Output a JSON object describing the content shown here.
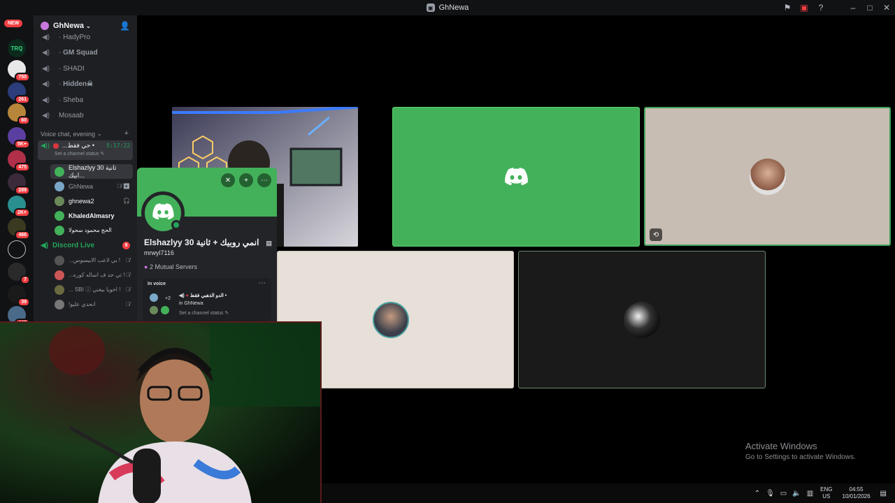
{
  "window": {
    "title": "GhNewa"
  },
  "server_rail": {
    "new_label": "NEW",
    "badges": [
      "750",
      "261",
      "60",
      "5K+",
      "475",
      "289",
      "2K+",
      "466",
      "7",
      "39",
      "445"
    ],
    "logo_text": "TRQ"
  },
  "guild": {
    "name": "GhNewa"
  },
  "channels": {
    "top": [
      {
        "name": "HadyPro",
        "prefix": "·"
      },
      {
        "name": "GM Squad",
        "prefix": "·"
      },
      {
        "name": "SHADI",
        "prefix": "·"
      },
      {
        "name": "Hidden☠",
        "prefix": "·"
      },
      {
        "name": "Sheba",
        "prefix": "·"
      },
      {
        "name": "Mosaab",
        "prefix": ""
      }
    ],
    "category": "Voice chat, evening",
    "active": {
      "name": "...حي فقط •",
      "timer": "5:17:22",
      "status": "Set a channel status"
    },
    "members": [
      {
        "name": "Elshazlyy 30 ثانية ابيك...",
        "color": "#43b15a"
      },
      {
        "name": "GhNewa",
        "color": "#7aa7c7"
      },
      {
        "name": "ghnewa2",
        "color": "#6b8a5a"
      },
      {
        "name": "KhaledAlmasry",
        "color": "#43b15a"
      },
      {
        "name": "الحج محمود سحولا",
        "color": "#43b15a"
      }
    ],
    "live_category": "Discord Live",
    "live_count": "9",
    "live_members": [
      {
        "name": "...بي لاعب الابيسوس !",
        "color": "#555"
      },
      {
        "name": "...تي حد ف اساله كوره !",
        "color": "#c55"
      },
      {
        "name": "... SBI ⓘ اخويا بيغني !",
        "color": "#6a6a40"
      },
      {
        "name": "!انحدي عليو",
        "color": "#777"
      }
    ]
  },
  "popout": {
    "display_name": "Elshazlyy 30 انمي روبيك + ثانية",
    "handle": "mrwyl7116",
    "mutual": "2 Mutual Servers",
    "in_voice_label": "In voice",
    "channel_name": "الدو الذهبي فقط •",
    "in_guild": "in GhNewa",
    "status": "Set a channel status",
    "plus_count": "+2"
  },
  "watermark": {
    "title": "Activate Windows",
    "subtitle": "Go to Settings to activate Windows."
  },
  "taskbar": {
    "lang_top": "ENG",
    "lang_bottom": "US",
    "time": "04:55",
    "date": "10/01/2026"
  }
}
